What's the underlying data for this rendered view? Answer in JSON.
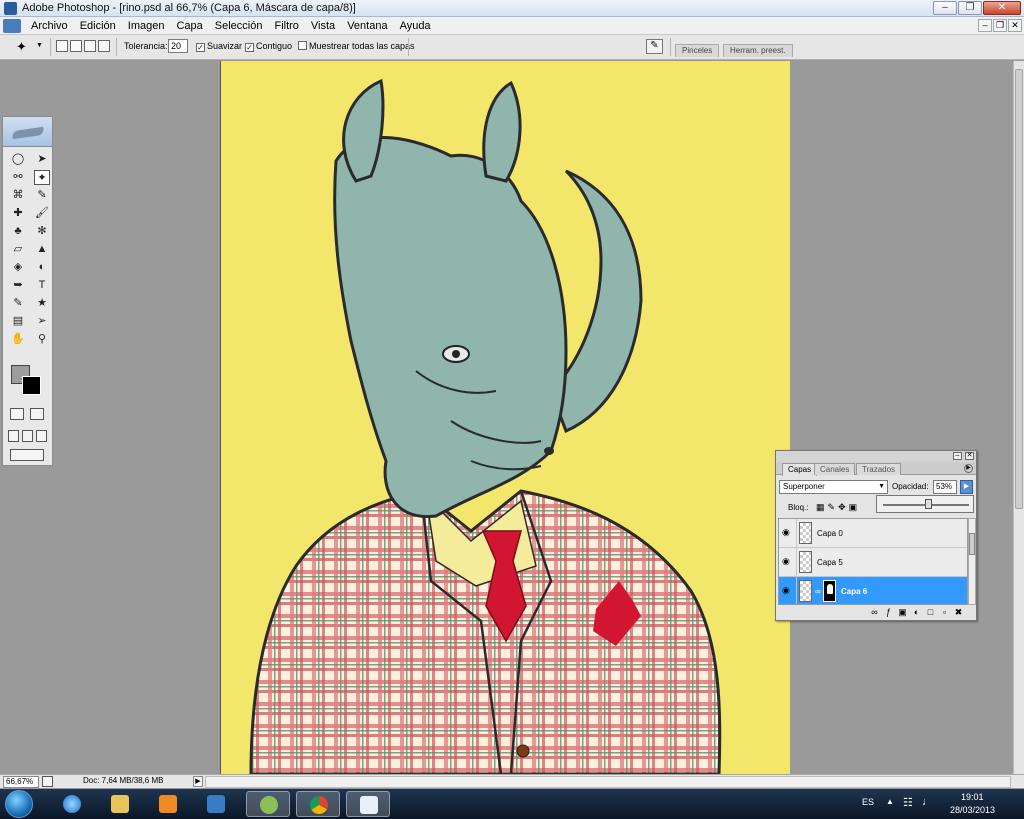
{
  "window": {
    "title": "Adobe Photoshop - [rino.psd al 66,7% (Capa 6, Máscara de capa/8)]"
  },
  "menu": [
    "Archivo",
    "Edición",
    "Imagen",
    "Capa",
    "Selección",
    "Filtro",
    "Vista",
    "Ventana",
    "Ayuda"
  ],
  "options": {
    "tolerance_label": "Tolerancia:",
    "tolerance_value": "20",
    "antialias_label": "Suavizar",
    "contiguous_label": "Contiguo",
    "sample_all_label": "Muestrear todas las capas",
    "antialias_checked": true,
    "contiguous_checked": true,
    "sample_all_checked": false,
    "palette_tabs": [
      "Pinceles",
      "Herram. preest."
    ]
  },
  "status": {
    "zoom": "66,67%",
    "doc": "Doc: 7,64 MB/38,6 MB"
  },
  "layers_panel": {
    "tabs": [
      "Capas",
      "Canales",
      "Trazados"
    ],
    "blend_mode": "Superponer",
    "opacity_label": "Opacidad:",
    "opacity_value": "53%",
    "opacity": 0.53,
    "lock_label": "Bloq.:",
    "layers": [
      {
        "name": "Capa 0",
        "visible": true,
        "selected": false
      },
      {
        "name": "Capa 5",
        "visible": true,
        "selected": false
      },
      {
        "name": "Capa 6",
        "visible": true,
        "selected": true,
        "has_mask": true
      }
    ]
  },
  "taskbar": {
    "language": "ES",
    "time": "19:01",
    "date": "28/03/2013",
    "apps": [
      "start-orb",
      "internet-explorer-icon",
      "folder-icon",
      "media-player-icon",
      "photoshop-icon",
      "network-app-icon",
      "chrome-icon",
      "pdf-reader-icon"
    ]
  },
  "colors": {
    "canvas_bg": "#f2e76a",
    "rhino": "#8fb5ad",
    "tie": "#d21530",
    "plaid_red": "#d8666a",
    "plaid_green": "#5d8f6f",
    "selection": "#3399ff"
  }
}
